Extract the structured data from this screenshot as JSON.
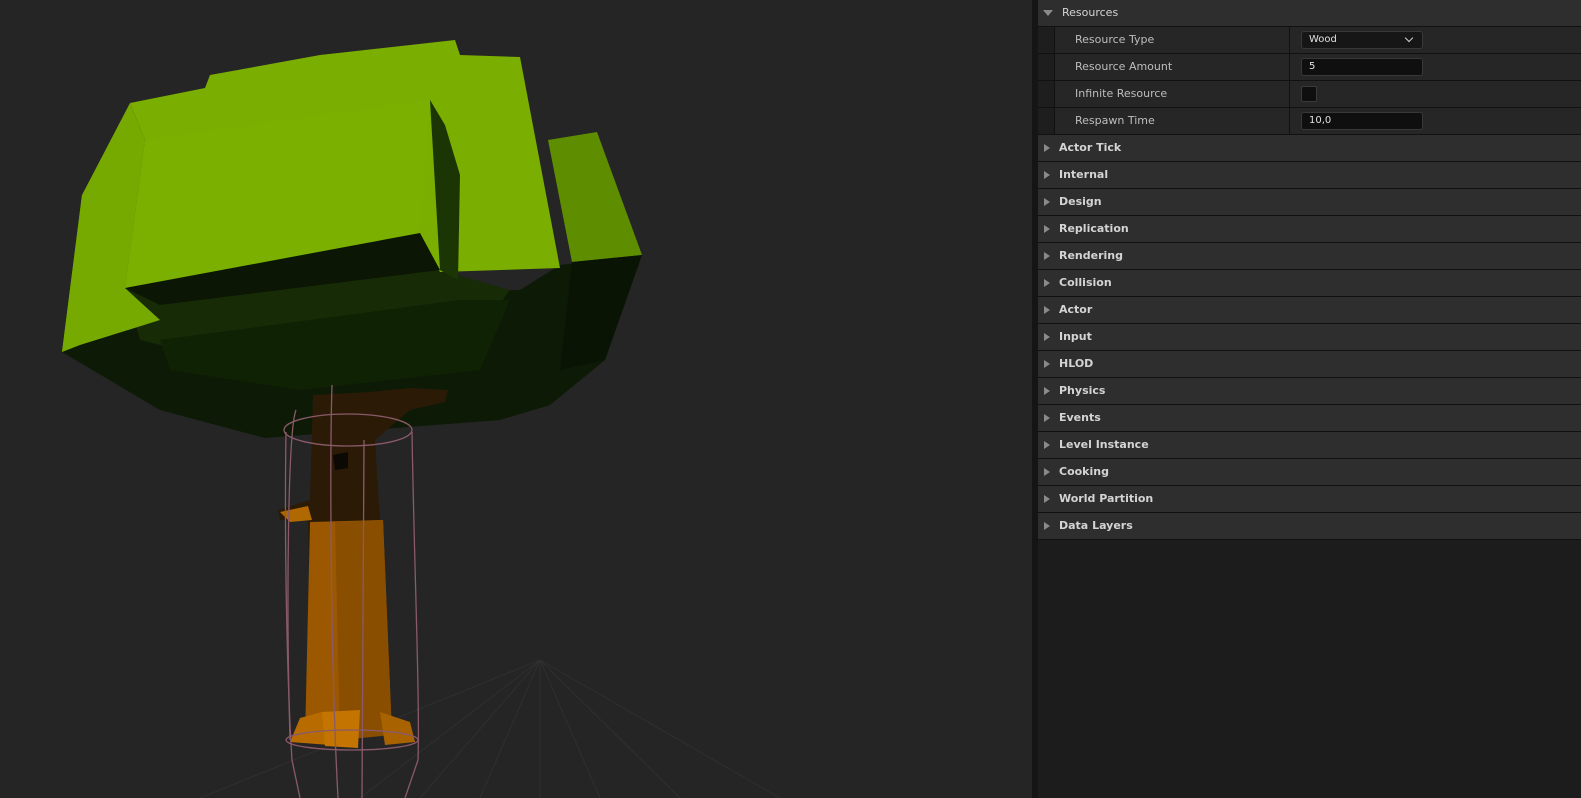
{
  "details": {
    "resources": {
      "title": "Resources",
      "properties": {
        "resource_type": {
          "name": "Resource Type",
          "value": "Wood"
        },
        "resource_amount": {
          "name": "Resource Amount",
          "value": "5"
        },
        "infinite_resource": {
          "name": "Infinite Resource",
          "checked": false
        },
        "respawn_time": {
          "name": "Respawn Time",
          "value": "10,0"
        }
      }
    },
    "categories": [
      "Actor Tick",
      "Internal",
      "Design",
      "Replication",
      "Rendering",
      "Collision",
      "Actor",
      "Input",
      "HLOD",
      "Physics",
      "Events",
      "Level Instance",
      "Cooking",
      "World Partition",
      "Data Layers"
    ]
  },
  "viewport": {
    "foliage_color": "#78ae00",
    "trunk_color": "#9c5800",
    "collision_capsule_color": "#8a5a6a"
  }
}
